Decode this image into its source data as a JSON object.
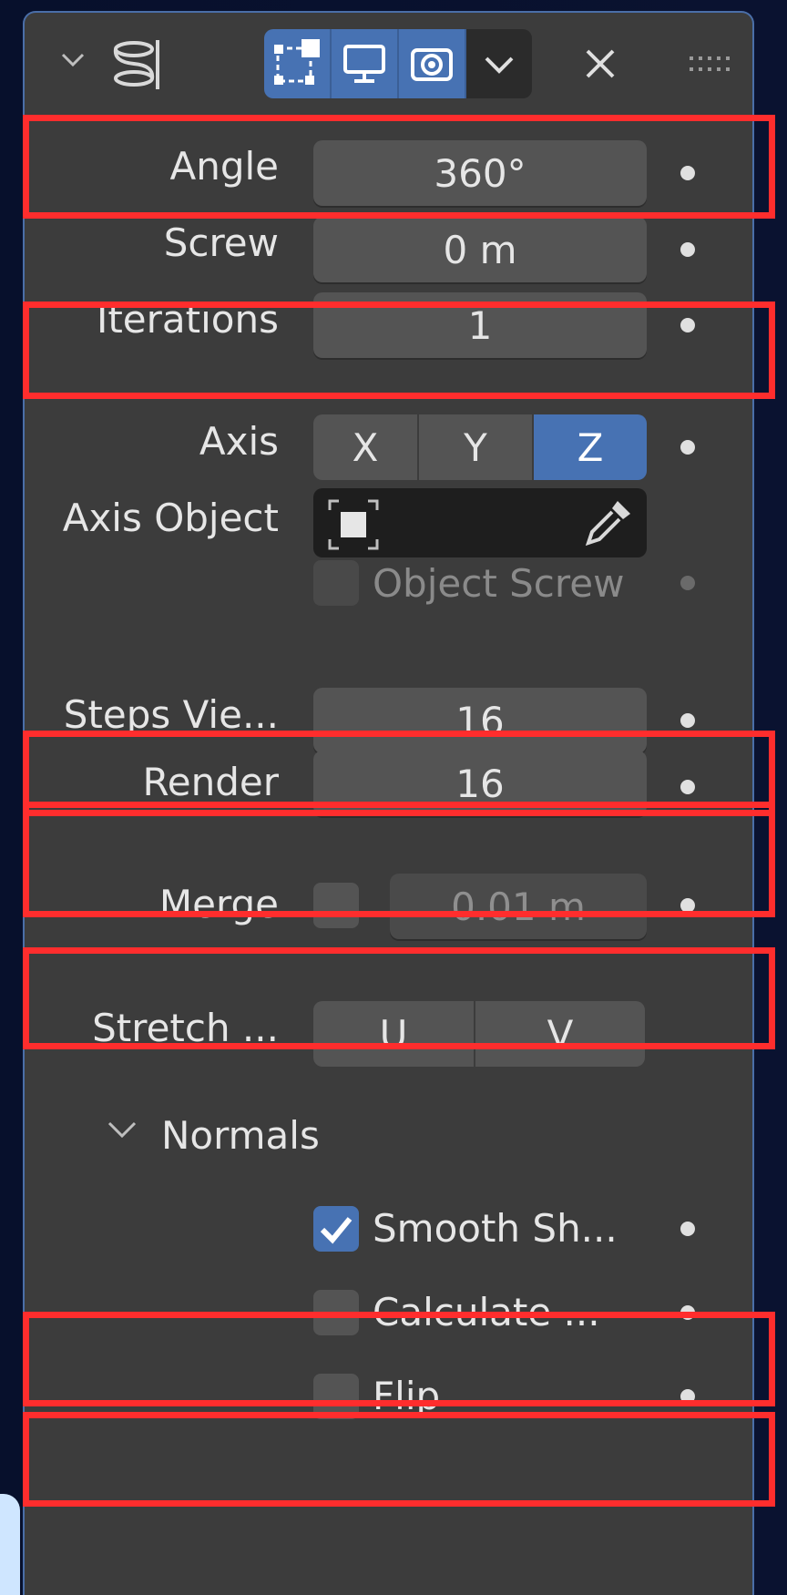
{
  "modifier": {
    "icon": "screw-modifier-icon",
    "header_buttons": [
      {
        "name": "edit-mode-toggle",
        "icon": "vertex-square-icon",
        "active": true
      },
      {
        "name": "viewport-toggle",
        "icon": "monitor-icon",
        "active": true
      },
      {
        "name": "render-toggle",
        "icon": "camera-icon",
        "active": true
      },
      {
        "name": "dropdown",
        "icon": "chevron-down-icon",
        "active": false
      }
    ]
  },
  "fields": {
    "angle": {
      "label": "Angle",
      "value": "360°"
    },
    "screw": {
      "label": "Screw",
      "value": "0 m"
    },
    "iterations": {
      "label": "Iterations",
      "value": "1"
    },
    "axis": {
      "label": "Axis",
      "options": [
        "X",
        "Y",
        "Z"
      ],
      "selected": "Z"
    },
    "axis_object": {
      "label": "Axis Object"
    },
    "object_screw": {
      "label": "Object Screw",
      "checked": false
    },
    "steps_viewport": {
      "label": "Steps Vie...",
      "value": "16"
    },
    "render": {
      "label": "Render",
      "value": "16"
    },
    "merge": {
      "label": "Merge",
      "value": "0.01 m",
      "checked": false
    },
    "stretch": {
      "label": "Stretch ...",
      "options": [
        "U",
        "V"
      ]
    }
  },
  "normals": {
    "section_label": "Normals",
    "smooth_shading": {
      "label": "Smooth Sh...",
      "checked": true
    },
    "calculate_order": {
      "label": "Calculate ...",
      "checked": false
    },
    "flip": {
      "label": "Flip",
      "checked": false
    }
  },
  "colors": {
    "accent": "#4772b3",
    "panel_bg": "#3c3c3c",
    "field_bg": "#545454",
    "highlight": "#ff2d2d"
  }
}
